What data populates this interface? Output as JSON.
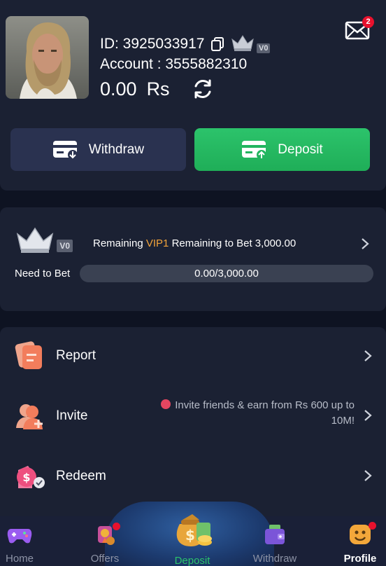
{
  "profile": {
    "id_label": "ID: 3925033917",
    "vip_level": "V0",
    "account_label": "Account : 3555882310",
    "balance": "0.00",
    "currency": "Rs",
    "mail_count": "2"
  },
  "actions": {
    "withdraw": "Withdraw",
    "deposit": "Deposit"
  },
  "vip": {
    "level_tag": "V0",
    "remaining_prefix": "Remaining ",
    "next_level": "VIP1",
    "remaining_suffix": " Remaining to Bet 3,000.00",
    "need_label": "Need to Bet",
    "progress_text": "0.00/3,000.00",
    "progress_fraction": 0
  },
  "menu": {
    "report": "Report",
    "invite": "Invite",
    "invite_note": "Invite friends & earn from Rs 600 up to 10M!",
    "redeem": "Redeem"
  },
  "nav": {
    "home": "Home",
    "offers": "Offers",
    "deposit": "Deposit",
    "withdraw": "Withdraw",
    "profile": "Profile"
  },
  "colors": {
    "accent_green": "#2cc36b",
    "highlight_orange": "#f2a33a",
    "badge_red": "#e8112d"
  }
}
